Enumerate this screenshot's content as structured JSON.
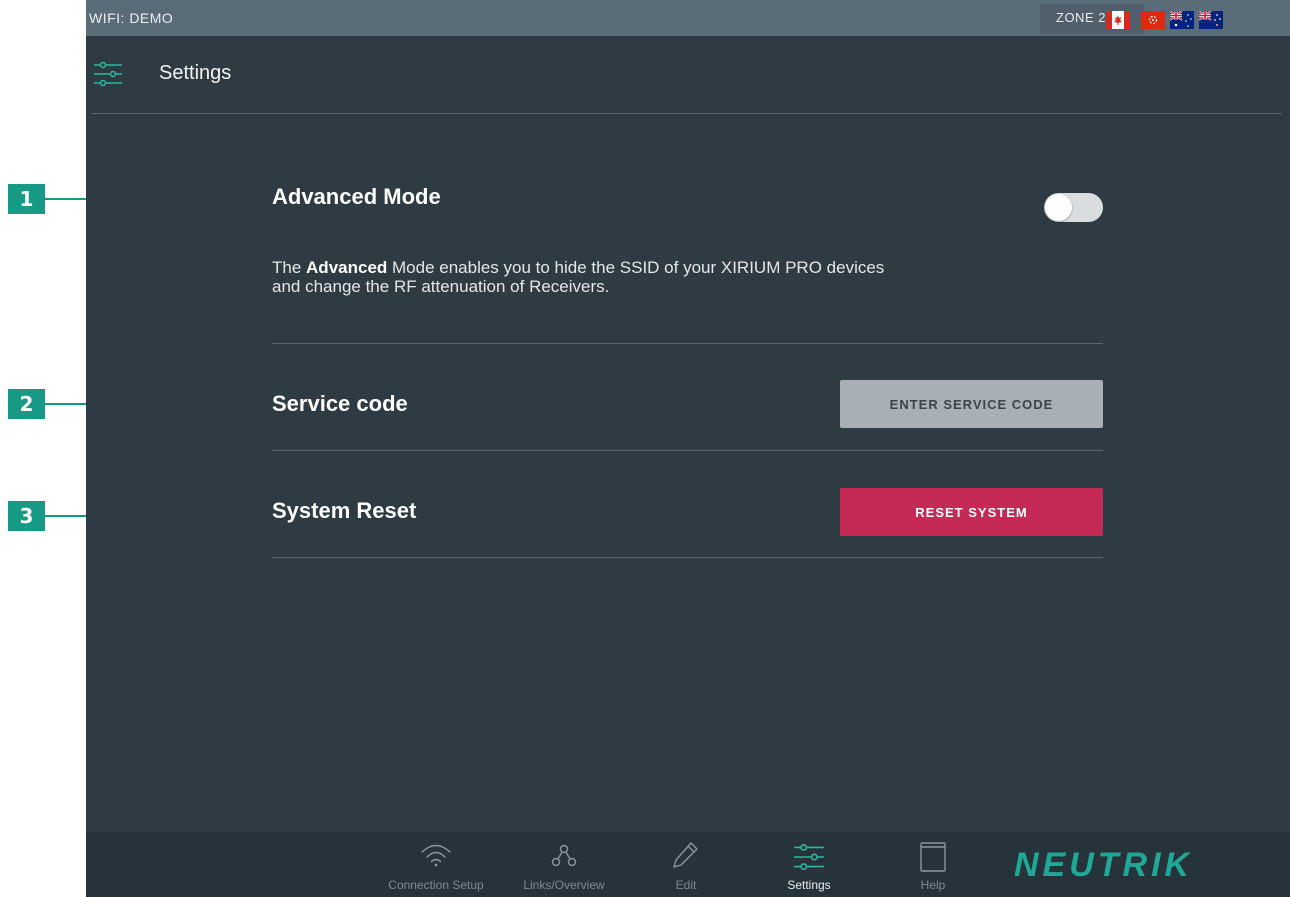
{
  "callouts": [
    "1",
    "2",
    "3"
  ],
  "statusbar": {
    "wifi": "WIFI: DEMO",
    "zone": "ZONE 2",
    "flags": [
      "canada-flag",
      "hong-kong-flag",
      "australia-flag",
      "new-zealand-flag"
    ]
  },
  "header": {
    "title": "Settings"
  },
  "advanced": {
    "title": "Advanced Mode",
    "desc_bold": "Advanced",
    "desc_pre": "The ",
    "desc_post": " Mode enables you to hide the SSID of your XIRIUM PRO devices and change the RF attenuation of Receivers.",
    "toggle_on": false
  },
  "service": {
    "title": "Service code",
    "button": "ENTER SERVICE CODE"
  },
  "reset": {
    "title": "System Reset",
    "button": "RESET SYSTEM"
  },
  "nav": [
    {
      "label": "Connection Setup",
      "icon": "wifi-icon"
    },
    {
      "label": "Links/Overview",
      "icon": "links-icon"
    },
    {
      "label": "Edit",
      "icon": "pencil-icon"
    },
    {
      "label": "Settings",
      "icon": "sliders-icon",
      "active": true
    },
    {
      "label": "Help",
      "icon": "book-icon"
    }
  ],
  "brand": {
    "name": "NEUTRIK",
    "color": "#1fa896"
  },
  "colors": {
    "accent": "#169a85",
    "background": "#2e3b43",
    "danger": "#c42a55"
  }
}
